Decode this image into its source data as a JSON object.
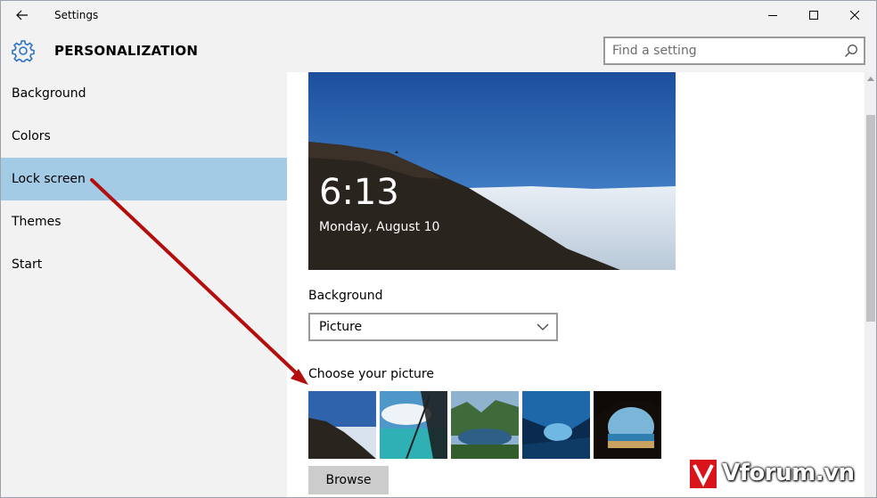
{
  "window": {
    "title": "Settings"
  },
  "header": {
    "title": "PERSONALIZATION",
    "icon": "gear-icon"
  },
  "search": {
    "placeholder": "Find a setting",
    "value": ""
  },
  "sidebar": {
    "items": [
      {
        "label": "Background",
        "active": false
      },
      {
        "label": "Colors",
        "active": false
      },
      {
        "label": "Lock screen",
        "active": true
      },
      {
        "label": "Themes",
        "active": false
      },
      {
        "label": "Start",
        "active": false
      }
    ]
  },
  "preview": {
    "time": "6:13",
    "date": "Monday, August 10"
  },
  "background_setting": {
    "label": "Background",
    "selected": "Picture"
  },
  "picture_chooser": {
    "label": "Choose your picture",
    "thumbnails": [
      "mountain-sky",
      "glass-beach",
      "lake-valley",
      "ice-cave",
      "rock-arch-beach"
    ],
    "browse_label": "Browse"
  },
  "colors": {
    "chrome": "#f2f2f2",
    "selection": "#a3cbe6",
    "button": "#cccccc",
    "arrow": "#b40d0d",
    "watermark": "#d9141b"
  },
  "watermark": {
    "text": "Vforum.vn"
  }
}
